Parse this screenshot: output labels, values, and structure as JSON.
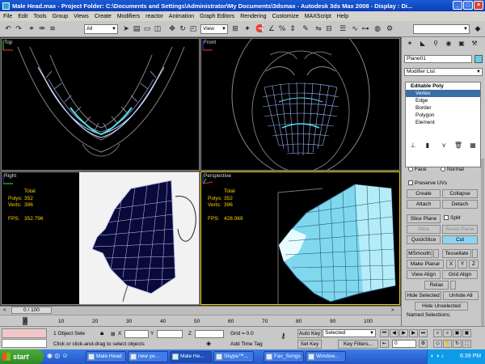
{
  "window": {
    "title": "Male Head.max - Project Folder: C:\\Documents and Settings\\Administrator\\My Documents\\3dsmax - Autodesk 3ds Max 2008 - Display : Di..."
  },
  "menu": [
    "File",
    "Edit",
    "Tools",
    "Group",
    "Views",
    "Create",
    "Modifiers",
    "reactor",
    "Animation",
    "Graph Editors",
    "Rendering",
    "Customize",
    "MAXScript",
    "Help"
  ],
  "toolbar": {
    "selection_filter": "All",
    "ref_coord": "View"
  },
  "viewports": {
    "top": {
      "label": "Top"
    },
    "front": {
      "label": "Front"
    },
    "right": {
      "label": "Right",
      "stats_header": "Total",
      "polys_label": "Polys:",
      "polys": "352",
      "verts_label": "Verts:",
      "verts": "396",
      "fps_label": "FPS:",
      "fps": "352.796"
    },
    "perspective": {
      "label": "Perspective",
      "stats_header": "Total",
      "polys_label": "Polys:",
      "polys": "352",
      "verts_label": "Verts:",
      "verts": "396",
      "fps_label": "FPS:",
      "fps": "428.069"
    }
  },
  "command_panel": {
    "object_name": "Plane01",
    "object_color": "#5fd0e6",
    "modifier_list": "Modifier List",
    "stack": {
      "header": "Editable Poly",
      "items": [
        "Vertex",
        "Edge",
        "Border",
        "Polygon",
        "Element"
      ],
      "selected_index": 0
    },
    "face_label": "Face",
    "normal_label": "Normal",
    "preserve_uvs": "Preserve UVs",
    "create": "Create",
    "collapse": "Collapse",
    "attach": "Attach",
    "detach": "Detach",
    "slice_plane": "Slice Plane",
    "split": "Split",
    "slice": "Slice",
    "reset_plane": "Reset Plane",
    "quickslice": "QuickSlice",
    "cut": "Cut",
    "msmooth": "MSmooth",
    "tessellate": "Tessellate",
    "make_planar": "Make Planar",
    "x": "X",
    "y": "Y",
    "z": "Z",
    "view_align": "View Align",
    "grid_align": "Grid Align",
    "relax": "Relax",
    "hide_selected": "Hide Selected",
    "unhide_all": "Unhide All",
    "hide_unselected": "Hide Unselected",
    "named_selections": "Named Selections:"
  },
  "timeline": {
    "frame": "0 / 100",
    "ticks": [
      "0",
      "10",
      "20",
      "30",
      "40",
      "50",
      "60",
      "70",
      "80",
      "90",
      "100"
    ]
  },
  "status": {
    "selected": "1 Object Sele",
    "x_label": "X",
    "y_label": "Y",
    "z_label": "Z",
    "grid": "Grid = 0.0",
    "auto_key": "Auto Key",
    "key_mode": "Selected",
    "set_key": "Set Key",
    "key_filters": "Key Filters...",
    "prompt": "Click or click-and-drag to select objects",
    "add_time_tag": "Add Time Tag",
    "frame_value": "0"
  },
  "taskbar": {
    "start": "start",
    "tasks": [
      "Male Head",
      "new ye...",
      "Male He...",
      "Skype™...",
      "Fav_Songs",
      "Window..."
    ],
    "clock": "6:39 PM"
  }
}
